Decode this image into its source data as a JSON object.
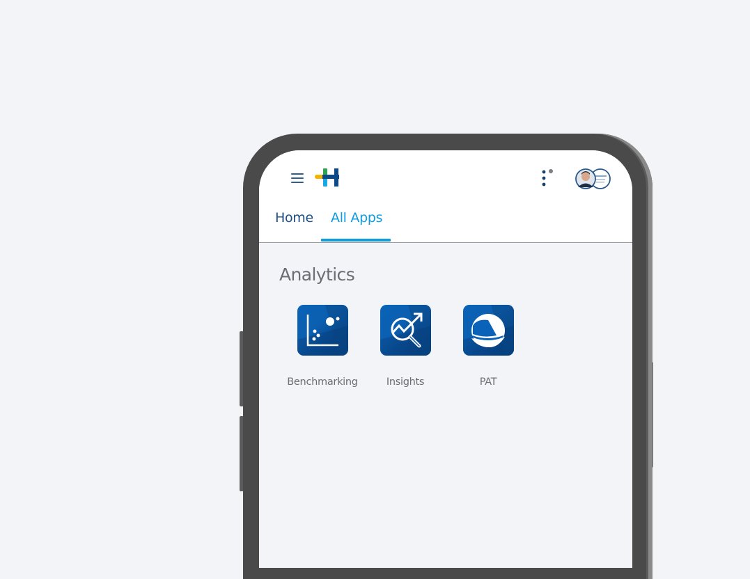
{
  "header": {
    "menu_icon": "hamburger-menu-icon",
    "logo_icon": "h-plus-logo-icon",
    "apps_icon": "kebab-dots-icon",
    "avatar_icon": "user-avatar-pair-icon"
  },
  "tabs": [
    {
      "label": "Home",
      "active": false
    },
    {
      "label": "All Apps",
      "active": true
    }
  ],
  "section": {
    "title": "Analytics",
    "apps": [
      {
        "label": "Benchmarking",
        "icon": "scatter-chart-icon"
      },
      {
        "label": "Insights",
        "icon": "magnifier-trend-icon"
      },
      {
        "label": "PAT",
        "icon": "globe-swoosh-icon"
      }
    ]
  },
  "colors": {
    "accent": "#0f9be0",
    "primary": "#1d4f83",
    "tile_blue": "#0a63b8",
    "background": "#f2f4f7",
    "frame": "#4a4a4a"
  }
}
